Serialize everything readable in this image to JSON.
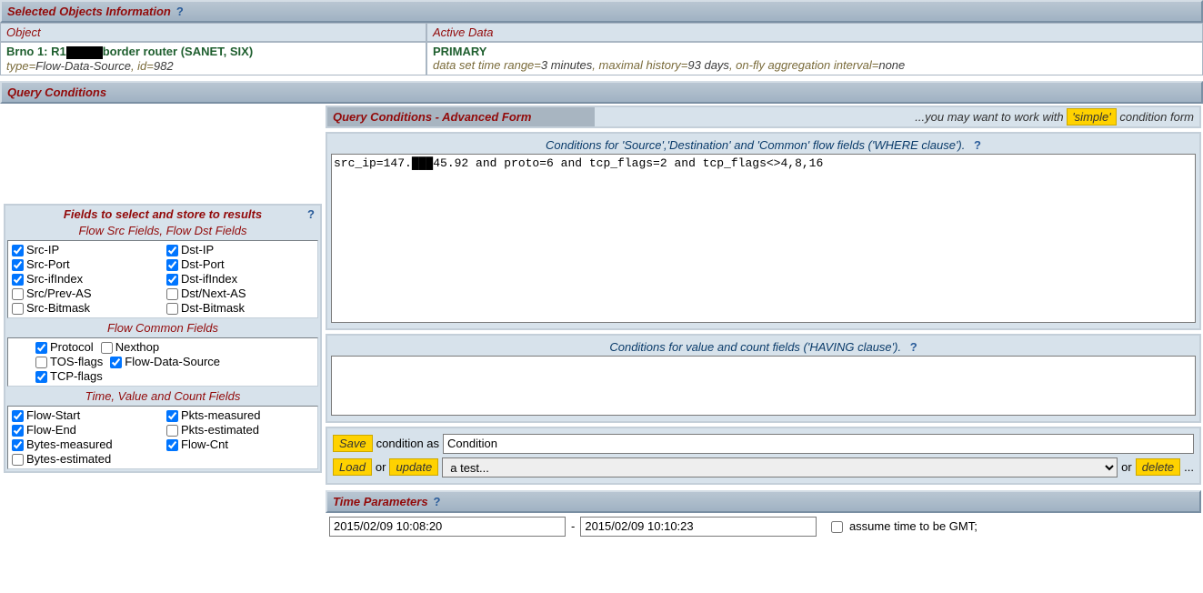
{
  "selected_objects": {
    "title": "Selected Objects Information",
    "object_header": "Object",
    "active_header": "Active Data",
    "object_name_pre": "Brno 1: R1",
    "object_name_post": "border router (SANET, SIX)",
    "type_label": "type=",
    "type_value": "Flow-Data-Source",
    "id_label": ", id=",
    "id_value": "982",
    "active_primary": "PRIMARY",
    "tr_label": "data set time range=",
    "tr_value": "3 minutes",
    "mh_label": ", maximal history=",
    "mh_value": "93 days",
    "agg_label": ", on-fly aggregation interval=",
    "agg_value": "none"
  },
  "query_conditions": {
    "title": "Query Conditions",
    "advanced_title": "Query Conditions - Advanced Form",
    "switch_hint_pre": "...you may want to work with ",
    "switch_btn": "'simple'",
    "switch_hint_post": " condition form",
    "where_label": "Conditions for 'Source','Destination' and 'Common' flow fields ('WHERE clause').",
    "where_value_pre": "src_ip=147.",
    "where_value_post": "45.92 and proto=6 and tcp_flags=2 and tcp_flags<>4,8,16",
    "having_label": "Conditions for value and count fields ('HAVING clause').",
    "having_value": "",
    "save_btn": "Save",
    "save_as": " condition as",
    "cond_name": "Condition",
    "load_btn": "Load",
    "or1": " or ",
    "update_btn": "update",
    "cond_select": "a test...",
    "or2": " or ",
    "delete_btn": "delete",
    "dots": " ..."
  },
  "fields": {
    "title": "Fields to select and store to results",
    "src_dst_title": "Flow Src Fields, Flow Dst Fields",
    "common_title": "Flow Common Fields",
    "time_title": "Time, Value and Count Fields",
    "src": [
      {
        "label": "Src-IP",
        "checked": true
      },
      {
        "label": "Src-Port",
        "checked": true
      },
      {
        "label": "Src-ifIndex",
        "checked": true
      },
      {
        "label": "Src/Prev-AS",
        "checked": false
      },
      {
        "label": "Src-Bitmask",
        "checked": false
      }
    ],
    "dst": [
      {
        "label": "Dst-IP",
        "checked": true
      },
      {
        "label": "Dst-Port",
        "checked": true
      },
      {
        "label": "Dst-ifIndex",
        "checked": true
      },
      {
        "label": "Dst/Next-AS",
        "checked": false
      },
      {
        "label": "Dst-Bitmask",
        "checked": false
      }
    ],
    "common": [
      {
        "label": "Protocol",
        "checked": true
      },
      {
        "label": "Nexthop",
        "checked": false
      },
      {
        "label": "TOS-flags",
        "checked": false
      },
      {
        "label": "Flow-Data-Source",
        "checked": true
      },
      {
        "label": "TCP-flags",
        "checked": true
      }
    ],
    "time": [
      {
        "label": "Flow-Start",
        "checked": true
      },
      {
        "label": "Flow-End",
        "checked": true
      },
      {
        "label": "Bytes-measured",
        "checked": true
      },
      {
        "label": "Bytes-estimated",
        "checked": false
      },
      {
        "label": "Pkts-measured",
        "checked": true
      },
      {
        "label": "Pkts-estimated",
        "checked": false
      },
      {
        "label": "Flow-Cnt",
        "checked": true
      }
    ]
  },
  "time_params": {
    "title": "Time Parameters",
    "from": "2015/02/09 10:08:20",
    "dash": "-",
    "to": "2015/02/09 10:10:23",
    "gmt_label": " assume time to be GMT;"
  }
}
